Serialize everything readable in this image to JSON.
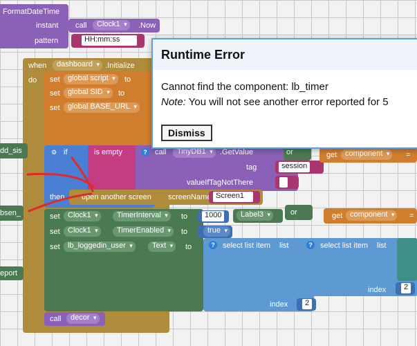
{
  "top_block": {
    "name": "FormatDateTime",
    "instant_label": "instant",
    "call_label": "call",
    "component": "Clock1",
    "method": ".Now",
    "pattern_label": "pattern",
    "pattern_value": "HH:mm:ss"
  },
  "event": {
    "when_label": "when",
    "component": "dashboard",
    "event": ".Initialize",
    "do_label": "do"
  },
  "set_rows": [
    {
      "set": "set",
      "var": "global script",
      "to": "to"
    },
    {
      "set": "set",
      "var": "global SID",
      "to": "to"
    },
    {
      "set": "set",
      "var": "global BASE_URL",
      "to": "to"
    }
  ],
  "if_block": {
    "if_label": "if",
    "is_empty": "is empty",
    "call_label": "call",
    "component": "TinyDB1",
    "method": ".GetValue",
    "tag_label": "tag",
    "tag_value": "session",
    "value_label": "valueIfTagNotThere",
    "value_value": "",
    "then_label": "then"
  },
  "right_partial": {
    "or_label": "or",
    "get_label": "get",
    "component_var": "component",
    "eq": "="
  },
  "open_screen": {
    "label": "open another screen",
    "screenName_label": "screenName",
    "value": "Screen1"
  },
  "left_partials": {
    "item1": "dd_sis",
    "item2": "bsen_",
    "item3": "eport"
  },
  "timer_rows": [
    {
      "set": "set",
      "component": "Clock1",
      "prop": "TimerInterval",
      "to": "to",
      "value": "1000"
    },
    {
      "set": "set",
      "component": "Clock1",
      "prop": "TimerEnabled",
      "to": "to",
      "value": "true"
    },
    {
      "set": "set",
      "component": "lb_loggedin_user",
      "prop": "Text",
      "to": "to"
    }
  ],
  "label3": "Label3",
  "select_list": [
    {
      "label": "select list item",
      "list_label": "list",
      "index_label": "index",
      "index_value": "2"
    },
    {
      "label": "select list item",
      "list_label": "list",
      "index_label": "index",
      "index_value": "2"
    }
  ],
  "call_decor": {
    "call": "call",
    "name": "decor"
  },
  "dialog": {
    "title": "Runtime Error",
    "message": "Cannot find the component: lb_timer",
    "note_label": "Note:",
    "note_text": " You will not see another error reported for 5",
    "button": "Dismiss"
  },
  "colors": {
    "orange": "#d07e2e",
    "brown": "#ae8c3c",
    "magenta": "#c43c82",
    "purple": "#8a61b6",
    "maroon": "#a9366e",
    "green": "#4b7a52",
    "blue": "#5d9ad4",
    "teal": "#3f8f89",
    "dialog_border": "#5aa0e6"
  }
}
